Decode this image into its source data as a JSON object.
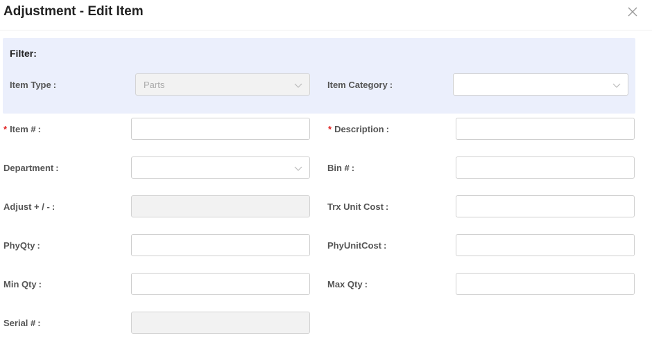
{
  "dialog": {
    "title": "Adjustment - Edit Item",
    "close_icon": "close-icon"
  },
  "filter": {
    "title": "Filter:",
    "item_type_label": "Item Type",
    "item_type_value": "Parts",
    "item_category_label": "Item Category",
    "item_category_value": ""
  },
  "form": {
    "required_mark": "*",
    "label_suffix": ":",
    "item_no_label": "Item #",
    "description_label": "Description",
    "department_label": "Department",
    "bin_label": "Bin #",
    "adjust_label": "Adjust + / -",
    "trx_unit_cost_label": "Trx Unit Cost",
    "phyqty_label": "PhyQty",
    "phyunitcost_label": "PhyUnitCost",
    "min_qty_label": "Min Qty",
    "max_qty_label": "Max Qty",
    "serial_label": "Serial #"
  },
  "colors": {
    "filter_bg": "#ebeffc",
    "required": "#e02020",
    "disabled_bg": "#f2f2f2"
  }
}
